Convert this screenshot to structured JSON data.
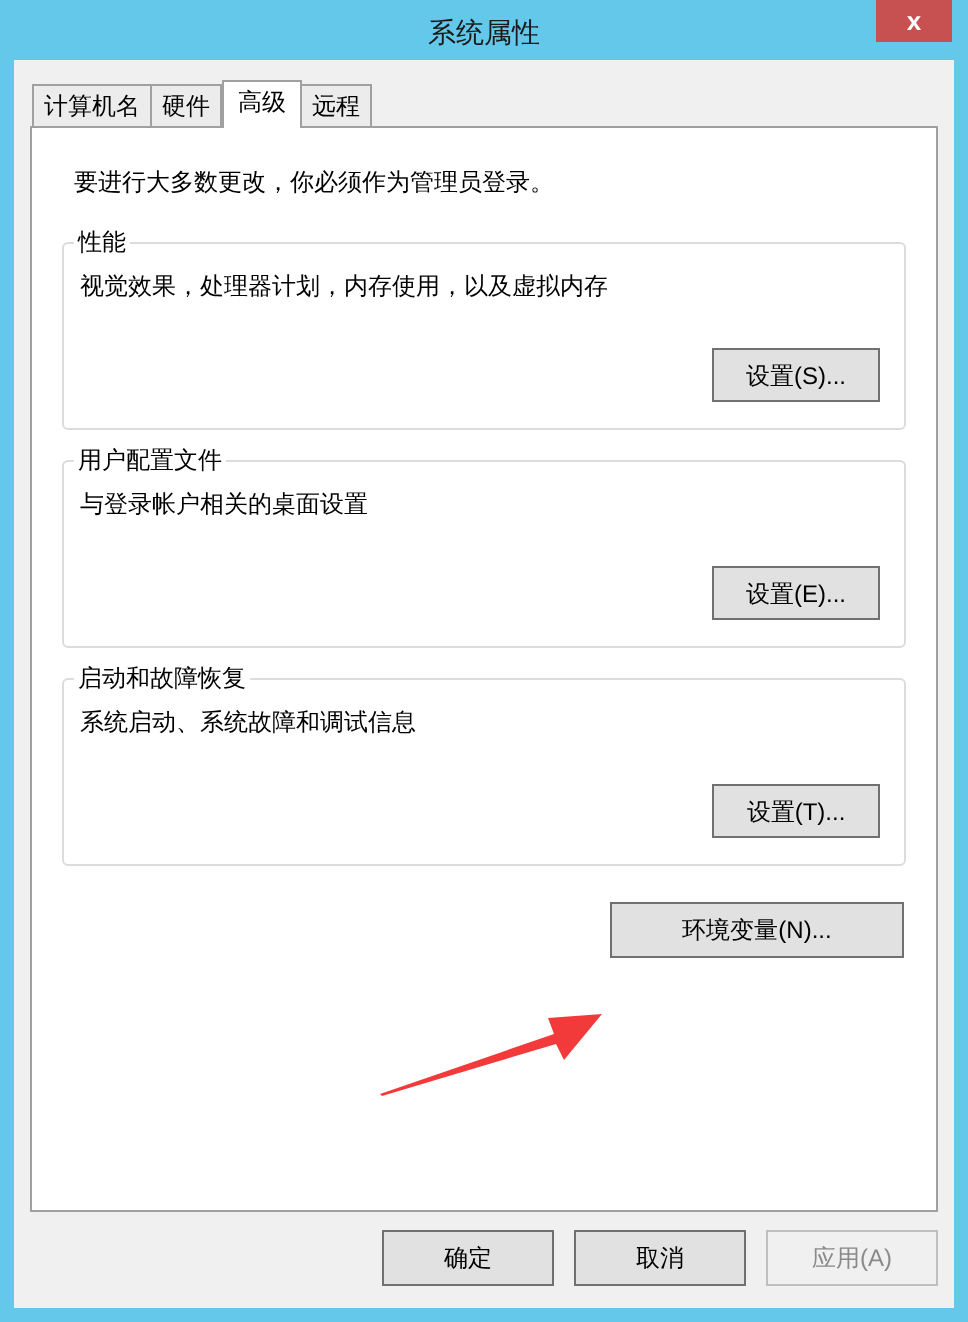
{
  "window": {
    "title": "系统属性",
    "close": "x"
  },
  "tabs": [
    {
      "label": "计算机名",
      "selected": false
    },
    {
      "label": "硬件",
      "selected": false
    },
    {
      "label": "高级",
      "selected": true
    },
    {
      "label": "远程",
      "selected": false
    }
  ],
  "notice": "要进行大多数更改，你必须作为管理员登录。",
  "groups": [
    {
      "title": "性能",
      "description": "视觉效果，处理器计划，内存使用，以及虚拟内存",
      "button": "设置(S)..."
    },
    {
      "title": "用户配置文件",
      "description": "与登录帐户相关的桌面设置",
      "button": "设置(E)..."
    },
    {
      "title": "启动和故障恢复",
      "description": "系统启动、系统故障和调试信息",
      "button": "设置(T)..."
    }
  ],
  "env_button": "环境变量(N)...",
  "buttons": [
    {
      "label": "确定",
      "disabled": false
    },
    {
      "label": "取消",
      "disabled": false
    },
    {
      "label": "应用(A)",
      "disabled": true
    }
  ]
}
